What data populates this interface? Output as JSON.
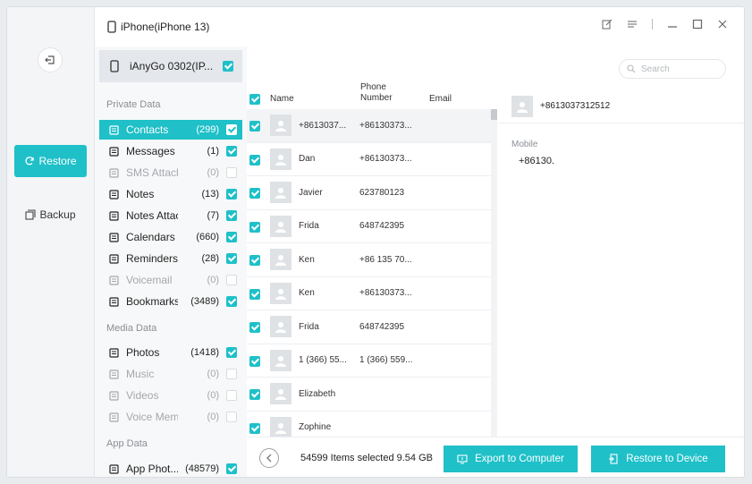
{
  "colors": {
    "accent": "#1fc0c8",
    "sidebar_bg": "#f4f5f7"
  },
  "titlebar": {
    "device_title": "iPhone(iPhone 13)"
  },
  "rail": {
    "restore_label": "Restore",
    "backup_label": "Backup"
  },
  "device_chip": {
    "label": "iAnyGo 0302(IP..."
  },
  "sections": {
    "private": "Private Data",
    "media": "Media Data",
    "app": "App Data"
  },
  "categories": [
    {
      "name": "Contacts",
      "count": "(299)",
      "icon": "contacts-icon",
      "checked": true,
      "active": true,
      "dim": false
    },
    {
      "name": "Messages",
      "count": "(1)",
      "icon": "messages-icon",
      "checked": true,
      "active": false,
      "dim": false
    },
    {
      "name": "SMS Attachm...",
      "count": "(0)",
      "icon": "sms-attachments-icon",
      "checked": false,
      "active": false,
      "dim": true
    },
    {
      "name": "Notes",
      "count": "(13)",
      "icon": "notes-icon",
      "checked": true,
      "active": false,
      "dim": false
    },
    {
      "name": "Notes Attach...",
      "count": "(7)",
      "icon": "notes-attachments-icon",
      "checked": true,
      "active": false,
      "dim": false
    },
    {
      "name": "Calendars",
      "count": "(660)",
      "icon": "calendar-icon",
      "checked": true,
      "active": false,
      "dim": false
    },
    {
      "name": "Reminders",
      "count": "(28)",
      "icon": "reminders-icon",
      "checked": true,
      "active": false,
      "dim": false
    },
    {
      "name": "Voicemail",
      "count": "(0)",
      "icon": "voicemail-icon",
      "checked": false,
      "active": false,
      "dim": true
    },
    {
      "name": "Bookmarks",
      "count": "(3489)",
      "icon": "bookmark-icon",
      "checked": true,
      "active": false,
      "dim": false
    },
    {
      "name": "Photos",
      "count": "(1418)",
      "icon": "photos-icon",
      "checked": true,
      "active": false,
      "dim": false
    },
    {
      "name": "Music",
      "count": "(0)",
      "icon": "music-icon",
      "checked": false,
      "active": false,
      "dim": true
    },
    {
      "name": "Videos",
      "count": "(0)",
      "icon": "video-icon",
      "checked": false,
      "active": false,
      "dim": true
    },
    {
      "name": "Voice Memos",
      "count": "(0)",
      "icon": "microphone-icon",
      "checked": false,
      "active": false,
      "dim": true
    },
    {
      "name": "App Phot...",
      "count": "(48579)",
      "icon": "app-photos-icon",
      "checked": true,
      "active": false,
      "dim": false
    }
  ],
  "list": {
    "headers": {
      "name": "Name",
      "phone_line1": "Phone",
      "phone_line2": "Number",
      "email": "Email"
    },
    "rows": [
      {
        "name": "+8613037...",
        "phone": "+86130373...",
        "selected": true
      },
      {
        "name": "Dan",
        "phone": "+86130373...",
        "selected": false
      },
      {
        "name": "Javier",
        "phone": "623780123",
        "selected": false
      },
      {
        "name": "Frida",
        "phone": "648742395",
        "selected": false
      },
      {
        "name": "Ken",
        "phone": "+86 135 70...",
        "selected": false
      },
      {
        "name": "Ken",
        "phone": "+86130373...",
        "selected": false
      },
      {
        "name": "Frida",
        "phone": "648742395",
        "selected": false
      },
      {
        "name": "1 (366) 55...",
        "phone": "1 (366) 559...",
        "selected": false
      },
      {
        "name": "Elizabeth",
        "phone": "",
        "selected": false
      },
      {
        "name": "Zophine",
        "phone": "",
        "selected": false
      }
    ]
  },
  "search": {
    "placeholder": "Search"
  },
  "detail": {
    "title": "+8613037312512",
    "field_label": "Mobile",
    "field_value": "+86130."
  },
  "footer": {
    "status": "54599 Items selected 9.54 GB",
    "export_label": "Export to Computer",
    "restore_label": "Restore to Device"
  }
}
